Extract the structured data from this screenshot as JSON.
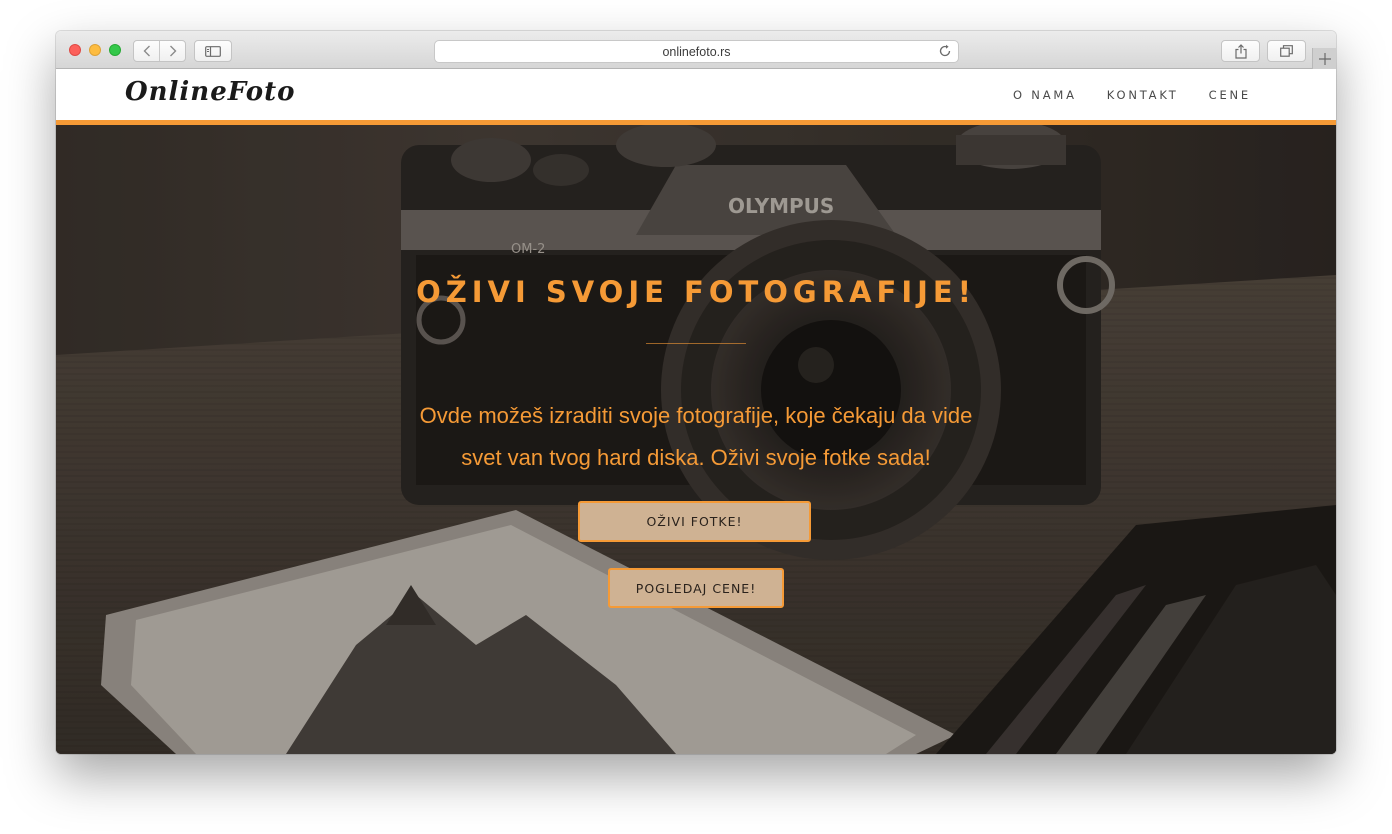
{
  "browser": {
    "url": "onlinefoto.rs",
    "icons": {
      "back": "chevron-left-icon",
      "forward": "chevron-right-icon",
      "sidebar": "sidebar-icon",
      "reload": "reload-icon",
      "share": "share-icon",
      "tabs": "tabs-icon",
      "new_tab": "plus-icon"
    }
  },
  "site": {
    "logo": "OnlineFoto",
    "nav": [
      {
        "label": "O NAMA"
      },
      {
        "label": "KONTAKT"
      },
      {
        "label": "CENE"
      }
    ],
    "accent_color": "#f59a36"
  },
  "hero": {
    "title": "OŽIVI SVOJE FOTOGRAFIJE!",
    "text_line1": "Ovde možeš izraditi svoje fotografije, koje čekaju da vide",
    "text_line2": "svet van tvog hard diska. Oživi svoje fotke sada!",
    "primary_button": "OŽIVI FOTKE!",
    "secondary_button": "POGLEDAJ CENE!",
    "background_subject": "OLYMPUS",
    "background_model": "OM-2"
  }
}
